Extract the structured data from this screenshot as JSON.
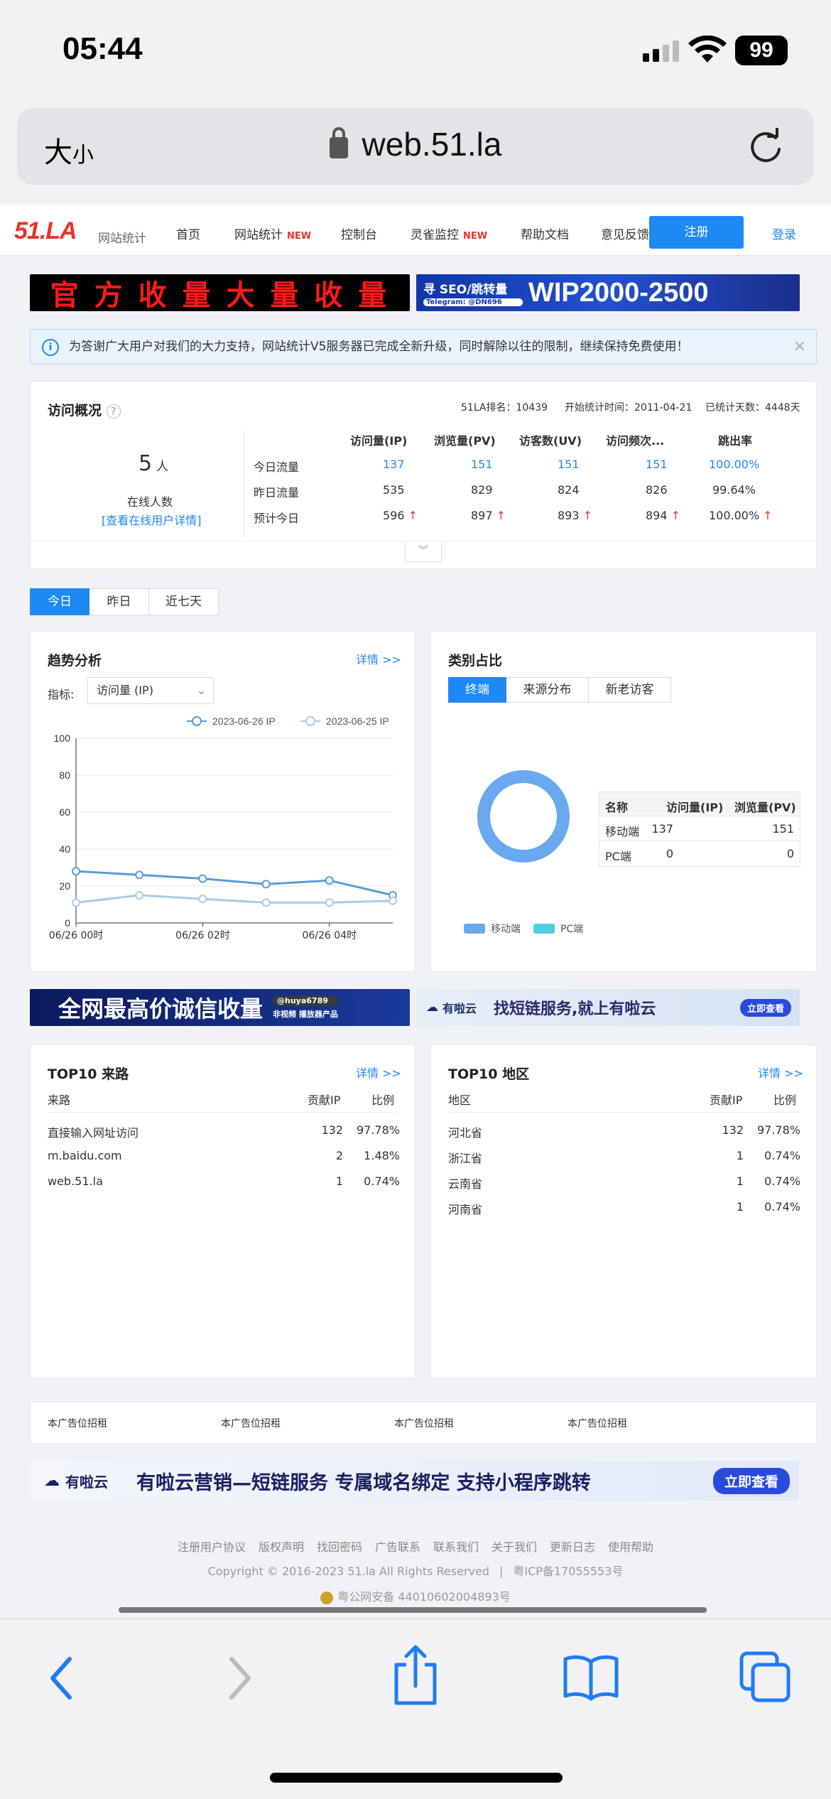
{
  "status_bar": {
    "time": "05:44",
    "battery": "99"
  },
  "browser": {
    "text_size_big": "大",
    "text_size_small": "小",
    "url": "web.51.la"
  },
  "nav": {
    "logo": "51.LA",
    "logo_sub": "网站统计",
    "items": [
      {
        "label": "首页",
        "badge": ""
      },
      {
        "label": "网站统计",
        "badge": "NEW"
      },
      {
        "label": "控制台",
        "badge": ""
      },
      {
        "label": "灵雀监控",
        "badge": "NEW"
      },
      {
        "label": "帮助文档",
        "badge": ""
      },
      {
        "label": "意见反馈",
        "badge": ""
      }
    ],
    "register": "注册",
    "login": "登录"
  },
  "ads": {
    "top_left": "官 方 收 量 大 量 收 量",
    "top_right_title": "寻 SEO/跳转量",
    "top_right_sub": "Telegram: @DN696",
    "top_right_big": "WIP2000-2500",
    "mid_left": "全网最高价诚信收量",
    "mid_left_handle": "@huya6789",
    "mid_left_sub": "非视频 播放器产品",
    "mid_right_brand": "有啦云",
    "mid_right_text": "找短链服务,就上有啦云",
    "mid_right_btn": "立即查看",
    "rent": [
      "本广告位招租",
      "本广告位招租",
      "本广告位招租",
      "本广告位招租"
    ],
    "bottom_brand": "有啦云",
    "bottom_text": "有啦云营销—短链服务 专属域名绑定 支持小程序跳转",
    "bottom_btn": "立即查看"
  },
  "notice": "为答谢广大用户对我们的大力支持，网站统计V5服务器已完成全新升级，同时解除以往的限制，继续保持免费使用！",
  "overview": {
    "title": "访问概况",
    "rank": "51LA排名：10439",
    "start": "开始统计时间：2011-04-21",
    "days": "已统计天数：4448天",
    "online_count": "5",
    "online_unit": "人",
    "online_label": "在线人数",
    "online_link": "[查看在线用户详情]",
    "headers": [
      "访问量(IP)",
      "浏览量(PV)",
      "访客数(UV)",
      "访问频次...",
      "跳出率"
    ],
    "rows": [
      {
        "label": "今日流量",
        "values": [
          "137",
          "151",
          "151",
          "151",
          "100.00%"
        ]
      },
      {
        "label": "昨日流量",
        "values": [
          "535",
          "829",
          "824",
          "826",
          "99.64%"
        ]
      },
      {
        "label": "预计今日",
        "values": [
          "596",
          "897",
          "893",
          "894",
          "100.00%"
        ]
      }
    ]
  },
  "day_tabs": [
    "今日",
    "昨日",
    "近七天"
  ],
  "trend": {
    "title": "趋势分析",
    "detail": "详情 >>",
    "metric_label": "指标:",
    "metric_value": "访问量 (IP)",
    "legend": [
      "2023-06-26 IP",
      "2023-06-25 IP"
    ]
  },
  "chart_data": {
    "type": "line",
    "x": [
      "06/26 00时",
      "06/26 01时",
      "06/26 02时",
      "06/26 03时",
      "06/26 04时",
      "06/26 05时"
    ],
    "xticks": [
      "06/26 00时",
      "06/26 02时",
      "06/26 04时"
    ],
    "ylim": [
      0,
      100
    ],
    "yticks": [
      0,
      20,
      40,
      60,
      80,
      100
    ],
    "series": [
      {
        "name": "2023-06-26 IP",
        "values": [
          28,
          26,
          24,
          21,
          23,
          15
        ],
        "color": "#5b9bd5"
      },
      {
        "name": "2023-06-25 IP",
        "values": [
          11,
          15,
          13,
          11,
          11,
          12
        ],
        "color": "#a8cce8"
      }
    ]
  },
  "category": {
    "title": "类别占比",
    "tabs": [
      "终端",
      "来源分布",
      "新老访客"
    ],
    "table_headers": [
      "名称",
      "访问量(IP)",
      "浏览量(PV)"
    ],
    "rows": [
      {
        "name": "移动端",
        "ip": "137",
        "pv": "151"
      },
      {
        "name": "PC端",
        "ip": "0",
        "pv": "0"
      }
    ],
    "legend": [
      "移动端",
      "PC端"
    ],
    "colors": {
      "mobile": "#6aa8f0",
      "pc": "#4fcfe0"
    }
  },
  "top_sources": {
    "title": "TOP10 来路",
    "detail": "详情 >>",
    "headers": [
      "来路",
      "贡献IP",
      "比例"
    ],
    "rows": [
      {
        "name": "直接输入网址访问",
        "ip": "132",
        "pct": "97.78%"
      },
      {
        "name": "m.baidu.com",
        "ip": "2",
        "pct": "1.48%"
      },
      {
        "name": "web.51.la",
        "ip": "1",
        "pct": "0.74%"
      }
    ]
  },
  "top_regions": {
    "title": "TOP10 地区",
    "detail": "详情 >>",
    "headers": [
      "地区",
      "贡献IP",
      "比例"
    ],
    "rows": [
      {
        "name": "河北省",
        "ip": "132",
        "pct": "97.78%"
      },
      {
        "name": "浙江省",
        "ip": "1",
        "pct": "0.74%"
      },
      {
        "name": "云南省",
        "ip": "1",
        "pct": "0.74%"
      },
      {
        "name": "河南省",
        "ip": "1",
        "pct": "0.74%"
      }
    ]
  },
  "footer": {
    "links": [
      "注册用户协议",
      "版权声明",
      "找回密码",
      "广告联系",
      "联系我们",
      "关于我们",
      "更新日志",
      "使用帮助"
    ],
    "copyright": "Copyright © 2016-2023 51.la All Rights Reserved",
    "icp": "粤ICP备17055553号",
    "police": "粤公网安备 44010602004893号"
  }
}
